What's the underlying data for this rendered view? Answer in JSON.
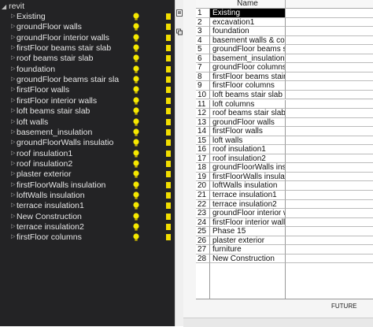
{
  "tree": {
    "root_label": "revit",
    "items": [
      {
        "label": "Existing"
      },
      {
        "label": "groundFloor walls"
      },
      {
        "label": "groundFloor interior walls"
      },
      {
        "label": "firstFloor beams stair slab"
      },
      {
        "label": "roof beams stair slab"
      },
      {
        "label": "foundation"
      },
      {
        "label": "groundFloor beams stair sla"
      },
      {
        "label": "firstFloor walls"
      },
      {
        "label": "firstFloor interior walls"
      },
      {
        "label": "loft beams stair slab"
      },
      {
        "label": "loft walls"
      },
      {
        "label": "basement_insulation"
      },
      {
        "label": "groundFloorWalls insulatio"
      },
      {
        "label": "roof insulation1"
      },
      {
        "label": "roof insulation2"
      },
      {
        "label": "plaster exterior"
      },
      {
        "label": "firstFloorWalls insulation"
      },
      {
        "label": "loftWalls insulation"
      },
      {
        "label": "terrace insulation1"
      },
      {
        "label": "New Construction"
      },
      {
        "label": "terrace insulation2"
      },
      {
        "label": "firstFloor columns"
      }
    ],
    "bulb_color": "#f5e800",
    "swatch_color": "#f2de00"
  },
  "sheet": {
    "column_header": "Name",
    "rows": [
      {
        "num": "1",
        "name": "Existing"
      },
      {
        "num": "2",
        "name": "excavation1"
      },
      {
        "num": "3",
        "name": "foundation"
      },
      {
        "num": "4",
        "name": "basement walls & colum"
      },
      {
        "num": "5",
        "name": "groundFloor beams stair"
      },
      {
        "num": "6",
        "name": "basement_insulation"
      },
      {
        "num": "7",
        "name": "groundFloor columns"
      },
      {
        "num": "8",
        "name": "firstFloor beams stair sla"
      },
      {
        "num": "9",
        "name": "firstFloor columns"
      },
      {
        "num": "10",
        "name": "loft beams stair slab"
      },
      {
        "num": "11",
        "name": "loft columns"
      },
      {
        "num": "12",
        "name": "roof beams stair slab"
      },
      {
        "num": "13",
        "name": "groundFloor walls"
      },
      {
        "num": "14",
        "name": "firstFloor walls"
      },
      {
        "num": "15",
        "name": "loft walls"
      },
      {
        "num": "16",
        "name": "roof insulation1"
      },
      {
        "num": "17",
        "name": "roof insulation2"
      },
      {
        "num": "18",
        "name": "groundFloorWalls insulat"
      },
      {
        "num": "19",
        "name": "firstFloorWalls insulation"
      },
      {
        "num": "20",
        "name": "loftWalls insulation"
      },
      {
        "num": "21",
        "name": "terrace insulation1"
      },
      {
        "num": "22",
        "name": "terrace insulation2"
      },
      {
        "num": "23",
        "name": "groundFloor interior wall"
      },
      {
        "num": "24",
        "name": "firstFloor interior walls"
      },
      {
        "num": "25",
        "name": "Phase 15"
      },
      {
        "num": "26",
        "name": "plaster exterior"
      },
      {
        "num": "27",
        "name": "furniture"
      },
      {
        "num": "28",
        "name": "New Construction"
      }
    ],
    "selected_row": "1",
    "footer": "FUTURE"
  }
}
